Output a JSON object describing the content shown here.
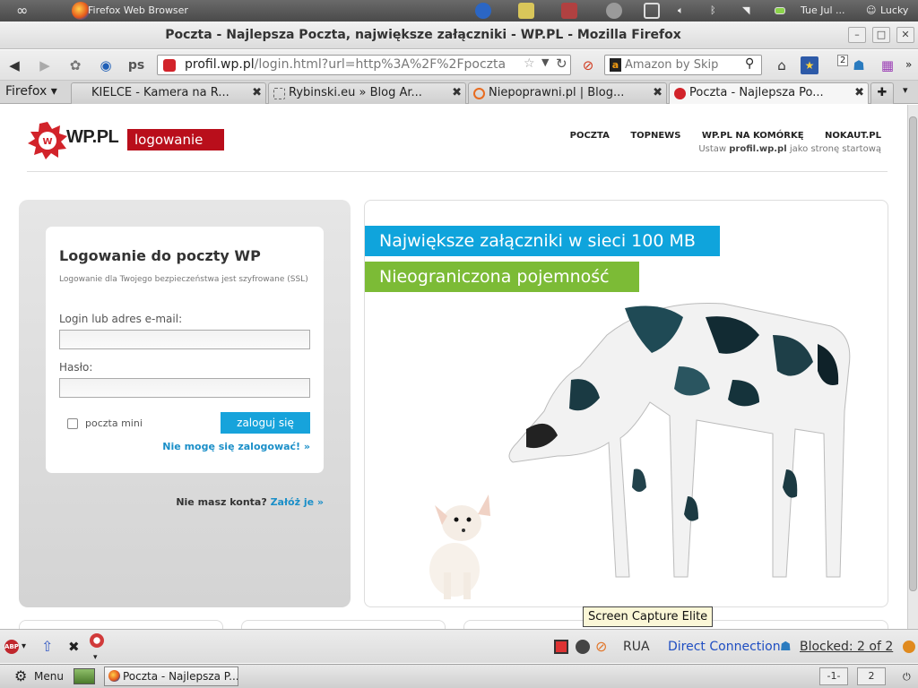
{
  "system": {
    "app_label": "Firefox Web Browser",
    "clock": "Tue Jul ...",
    "user": "Lucky"
  },
  "window": {
    "title": "Poczta - Najlepsza Poczta, największe załączniki - WP.PL - Mozilla Firefox"
  },
  "navbar": {
    "url_host": "profil.wp.pl",
    "url_path": "/login.html?url=http%3A%2F%2Fpoczta",
    "search_placeholder": "Amazon by Skip",
    "badge_count": "2"
  },
  "tabs": {
    "firefox_menu": "Firefox",
    "items": [
      {
        "label": "KIELCE - Kamera na R..."
      },
      {
        "label": "Rybinski.eu » Blog Ar..."
      },
      {
        "label": "Niepoprawni.pl | Blog..."
      },
      {
        "label": "Poczta - Najlepsza Po..."
      }
    ]
  },
  "page": {
    "logo_text": "WP.PL",
    "logowanie": "logowanie",
    "topnav": [
      "POCZTA",
      "TOPNEWS",
      "WP.PL NA KOMÓRKĘ",
      "NOKAUT.PL"
    ],
    "startpage_prefix": "Ustaw ",
    "startpage_site": "profil.wp.pl",
    "startpage_suffix": " jako stronę startową",
    "login": {
      "title": "Logowanie do poczty WP",
      "subtitle": "Logowanie dla Twojego bezpieczeństwa jest szyfrowane (SSL)",
      "login_label": "Login lub adres e-mail:",
      "password_label": "Hasło:",
      "mini_label": "poczta mini",
      "submit": "zaloguj się",
      "forgot": "Nie mogę się zalogować! »",
      "no_account": "Nie masz konta?",
      "register": "Załóż je »"
    },
    "ad": {
      "line1": "Największe załączniki w sieci 100 MB",
      "line2": "Nieograniczona pojemność"
    }
  },
  "tooltip": "Screen Capture Elite",
  "addonbar": {
    "rua": "RUA",
    "connection": "Direct Connection",
    "blocked": "Blocked: 2 of 2"
  },
  "taskbar": {
    "menu": "Menu",
    "task": "Poczta - Najlepsza P...",
    "ws1": "-1-",
    "ws2": "2"
  },
  "colors": {
    "wp_red": "#b90e1b",
    "wp_blue": "#0fa4dc",
    "wp_green": "#7cbb36",
    "link_blue": "#1b8fc8"
  }
}
